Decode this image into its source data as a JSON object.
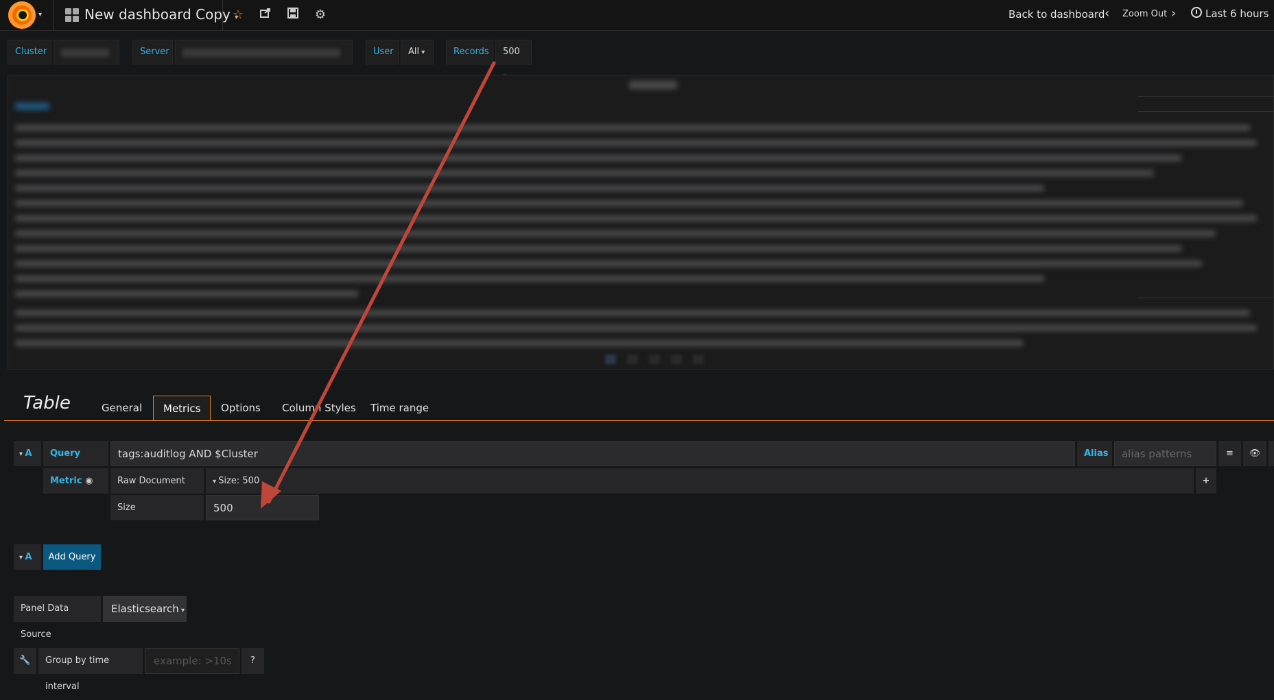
{
  "topnav": {
    "dashboard_title": "New dashboard Copy",
    "back_label": "Back to dashboard",
    "zoom_label": "Zoom Out",
    "time_range": "Last 6 hours"
  },
  "variables": {
    "cluster_label": "Cluster",
    "server_label": "Server",
    "user_label": "User",
    "user_value": "All",
    "records_label": "Records",
    "records_value": "500"
  },
  "editor": {
    "title": "Table",
    "tabs": [
      "General",
      "Metrics",
      "Options",
      "Column Styles",
      "Time range"
    ],
    "active_tab": "Metrics"
  },
  "query": {
    "ref": "A",
    "query_label": "Query",
    "query_text": "tags:auditlog AND $Cluster",
    "alias_label": "Alias",
    "alias_placeholder": "alias patterns",
    "metric_label": "Metric",
    "metric_type": "Raw Document",
    "size_summary": "Size: 500",
    "size_label": "Size",
    "size_value": "500"
  },
  "add_query": {
    "ref": "A",
    "label": "Add Query"
  },
  "datasource": {
    "label": "Panel Data Source",
    "value": "Elasticsearch"
  },
  "group_by": {
    "label": "Group by time interval",
    "placeholder": "example: >10s"
  },
  "colors": {
    "accent": "#eb7b18",
    "link": "#33b5e5",
    "arrow": "#c0463a",
    "button": "#0b5980"
  }
}
